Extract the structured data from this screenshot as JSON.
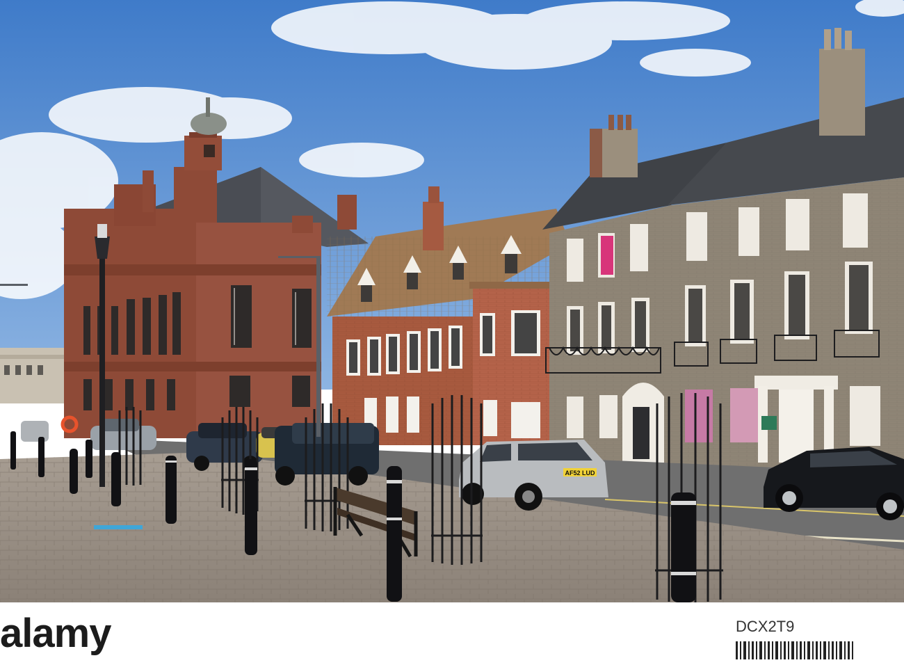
{
  "photo": {
    "subject": "Georgian and Victorian street with town hall, parked cars, bollards and a bench",
    "colors": {
      "sky": "#4f86cf",
      "sandstone": "#8e4a37",
      "brick": "#a85a3f",
      "grey_brick": "#8f8576",
      "pavement": "#9a9187",
      "road": "#6f6f6f"
    },
    "plates": {
      "silver_car": "AF52 LUD"
    }
  },
  "watermark": {
    "brand": "alamy",
    "image_id": "DCX2T9"
  }
}
